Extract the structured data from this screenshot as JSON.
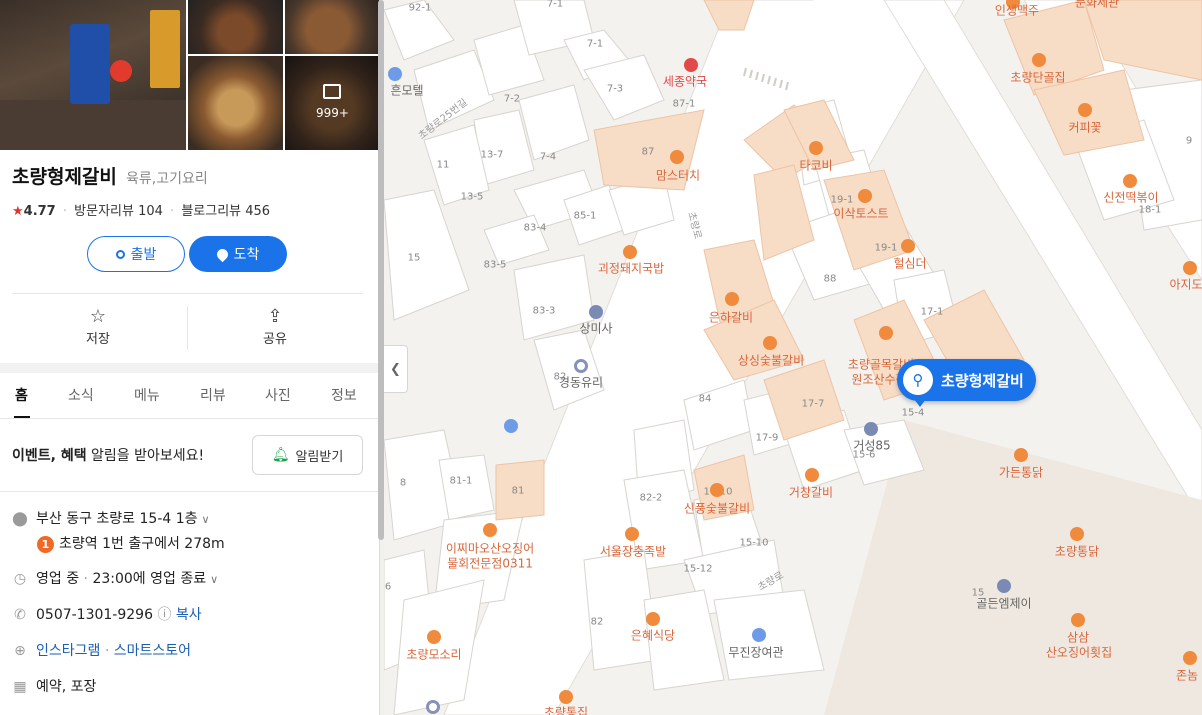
{
  "place": {
    "name": "초량형제갈비",
    "category": "육류,고기요리",
    "rating": "4.77",
    "visitor_reviews": "방문자리뷰 104",
    "blog_reviews": "블로그리뷰 456",
    "photo_count": "999+"
  },
  "buttons": {
    "depart": "출발",
    "arrive": "도착"
  },
  "actions": {
    "save": "저장",
    "share": "공유"
  },
  "tabs": [
    "홈",
    "소식",
    "메뉴",
    "리뷰",
    "사진",
    "정보"
  ],
  "notice": {
    "bold": "이벤트, 혜택",
    "text": " 알림을 받아보세요!",
    "button": "알림받기"
  },
  "info": {
    "address": "부산 동구 초량로 15-4 1층",
    "subway_line": "1",
    "subway": "초량역 1번 출구에서 278m",
    "hours_status": "영업 중",
    "hours_detail": "23:00에 영업 종료",
    "phone": "0507-1301-9296",
    "copy": "복사",
    "instagram": "인스타그램",
    "smartstore": "스마트스토어",
    "services": "예약, 포장"
  },
  "map": {
    "marker_label": "초량형제갈비",
    "pois": [
      {
        "text": "인생맥주",
        "color": "orange"
      },
      {
        "text": "초량단골집",
        "color": "orange"
      },
      {
        "text": "커피꽃",
        "color": "orange"
      },
      {
        "text": "신전떡볶이",
        "color": "orange"
      },
      {
        "text": "아지도",
        "color": "orange"
      },
      {
        "text": "세종약국",
        "color": "red"
      },
      {
        "text": "맘스터치",
        "color": "orange"
      },
      {
        "text": "타코비",
        "color": "orange"
      },
      {
        "text": "이삭토스트",
        "color": "orange"
      },
      {
        "text": "헐심더",
        "color": "orange"
      },
      {
        "text": "괴정돼지국밥",
        "color": "orange"
      },
      {
        "text": "은하갈비",
        "color": "orange"
      },
      {
        "text": "상싱숯불갈비",
        "color": "orange"
      },
      {
        "text": "초량골목갈비",
        "color": "orange"
      },
      {
        "text": "원조산수갑",
        "color": "orange"
      },
      {
        "text": "상미사",
        "color": "gray"
      },
      {
        "text": "경동유리",
        "color": "gray"
      },
      {
        "text": "거성85",
        "color": "gray"
      },
      {
        "text": "거창갈비",
        "color": "orange"
      },
      {
        "text": "가든통닭",
        "color": "orange"
      },
      {
        "text": "신풍숯불갈비",
        "color": "orange"
      },
      {
        "text": "이찌마오산오징어",
        "color": "orange"
      },
      {
        "text": "물회전문점0311",
        "color": "orange"
      },
      {
        "text": "서울장충족발",
        "color": "orange"
      },
      {
        "text": "초량통닭",
        "color": "orange"
      },
      {
        "text": "골든엠제이",
        "color": "gray"
      },
      {
        "text": "은혜식당",
        "color": "orange"
      },
      {
        "text": "무진장여관",
        "color": "gray"
      },
      {
        "text": "초량모소리",
        "color": "orange"
      },
      {
        "text": "삼삼",
        "color": "orange"
      },
      {
        "text": "산오징어횟집",
        "color": "orange"
      },
      {
        "text": "존놈",
        "color": "orange"
      },
      {
        "text": "흔모텔",
        "color": "gray"
      },
      {
        "text": "초량통집",
        "color": "orange"
      },
      {
        "text": "문화세관",
        "color": "orange"
      }
    ],
    "numbers": [
      "92-1",
      "7-1",
      "7-1",
      "7-3",
      "7-2",
      "87-1",
      "87",
      "7-4",
      "13-7",
      "11",
      "13-5",
      "85-1",
      "83-4",
      "83-5",
      "83-3",
      "15",
      "82",
      "84",
      "17-7",
      "17-9",
      "15-4",
      "15-6",
      "17-1",
      "19-1",
      "19-1",
      "88",
      "9",
      "18-1",
      "81-1",
      "81",
      "8",
      "82-2",
      "15-10",
      "15-12",
      "82",
      "6",
      "15",
      "14-10"
    ],
    "roads": [
      "초량로25번길",
      "초량로",
      "초량로"
    ],
    "colors": {
      "accent": "#1a73e8",
      "poi": "#d9663a",
      "building_highlight": "#f7dcc6"
    }
  }
}
